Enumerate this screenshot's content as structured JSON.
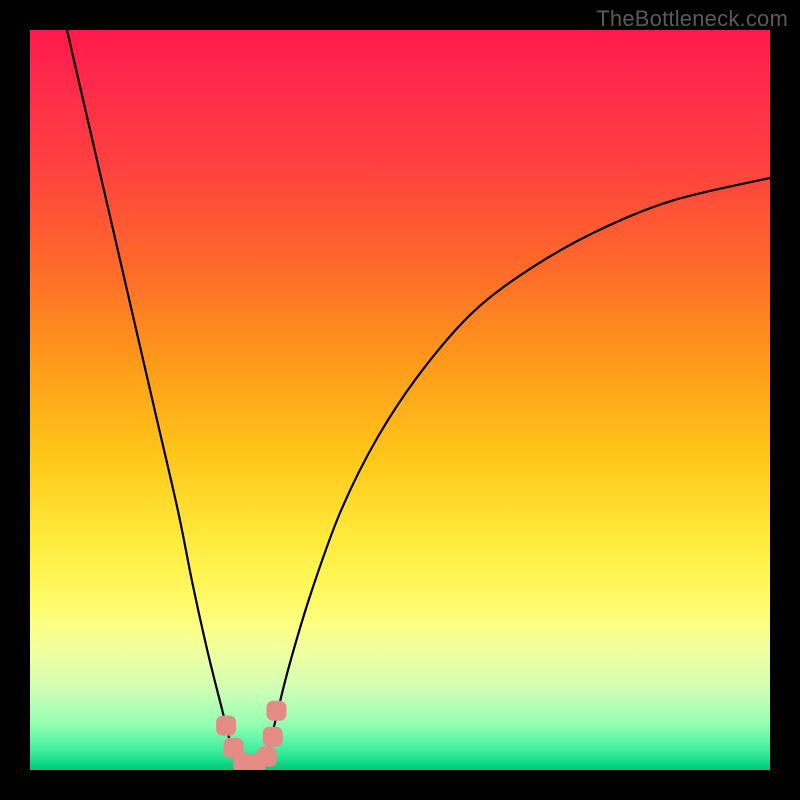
{
  "watermark": "TheBottleneck.com",
  "colors": {
    "frame": "#000000",
    "curve": "#000000",
    "marker": "#e58b85",
    "gradient_top": "#ff1a4d",
    "gradient_bottom": "#00c878"
  },
  "chart_data": {
    "type": "line",
    "title": "",
    "xlabel": "",
    "ylabel": "",
    "xlim": [
      0,
      100
    ],
    "ylim": [
      0,
      100
    ],
    "annotations": [
      "TheBottleneck.com"
    ],
    "series": [
      {
        "name": "bottleneck-curve",
        "x": [
          5,
          8,
          11,
          14,
          17,
          20,
          22,
          24,
          26,
          27,
          28,
          29,
          30,
          31,
          32,
          33,
          35,
          38,
          42,
          47,
          53,
          60,
          68,
          77,
          87,
          100
        ],
        "y": [
          100,
          87,
          74,
          61,
          48,
          35,
          25,
          16,
          8,
          4,
          1.5,
          0.5,
          0.5,
          0.5,
          2,
          6,
          14,
          24,
          35,
          45,
          54,
          62,
          68,
          73,
          77,
          80
        ]
      }
    ],
    "markers": {
      "name": "highlight-points",
      "x": [
        26.5,
        27.5,
        28.8,
        30.5,
        32.0,
        32.8,
        33.3
      ],
      "y": [
        6.0,
        3.0,
        1.0,
        0.8,
        1.8,
        4.5,
        8.0
      ]
    }
  }
}
